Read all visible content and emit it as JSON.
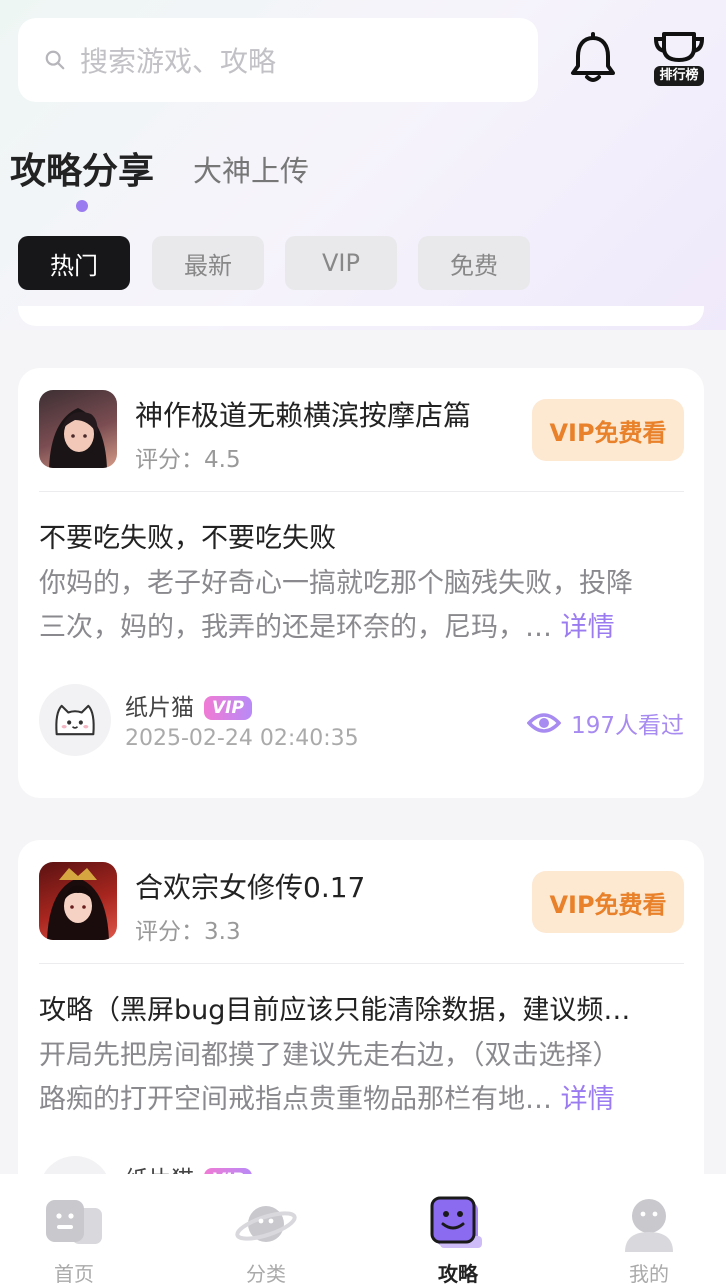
{
  "search": {
    "placeholder": "搜索游戏、攻略"
  },
  "header": {
    "rank_label": "排行榜"
  },
  "tabs": {
    "main": "攻略分享",
    "secondary": "大神上传"
  },
  "filters": [
    "热门",
    "最新",
    "VIP",
    "免费"
  ],
  "cards": [
    {
      "game_title": "神作极道无赖横滨按摩店篇",
      "score": "评分：4.5",
      "action_label": "VIP免费看",
      "heading": "不要吃失败，不要吃失败",
      "summary_line1": "你妈的，老子好奇心一搞就吃那个脑残失败，投降",
      "summary_line2": "三次，妈的，我弄的还是环奈的，尼玛，…",
      "more_label": "详情",
      "author": "纸片猫",
      "vip_badge": "VIP",
      "date": "2025-02-24 02:40:35",
      "views": "197人看过"
    },
    {
      "game_title": "合欢宗女修传0.17",
      "score": "评分：3.3",
      "action_label": "VIP免费看",
      "heading": "攻略（黑屏bug目前应该只能清除数据，建议频…",
      "summary_line1": "开局先把房间都摸了建议先走右边，（双击选择）",
      "summary_line2": "路痴的打开空间戒指点贵重物品那栏有地…",
      "more_label": "详情",
      "author": "纸片猫",
      "vip_badge": "VIP"
    }
  ],
  "nav": [
    {
      "label": "首页",
      "icon": "home-icon"
    },
    {
      "label": "分类",
      "icon": "planet-icon"
    },
    {
      "label": "攻略",
      "icon": "guide-book-icon",
      "active": true
    },
    {
      "label": "我的",
      "icon": "profile-icon"
    }
  ],
  "colors": {
    "accent": "#9b7cf0",
    "vip_orange": "#e8812a",
    "vip_bg": "#fde8d2"
  }
}
